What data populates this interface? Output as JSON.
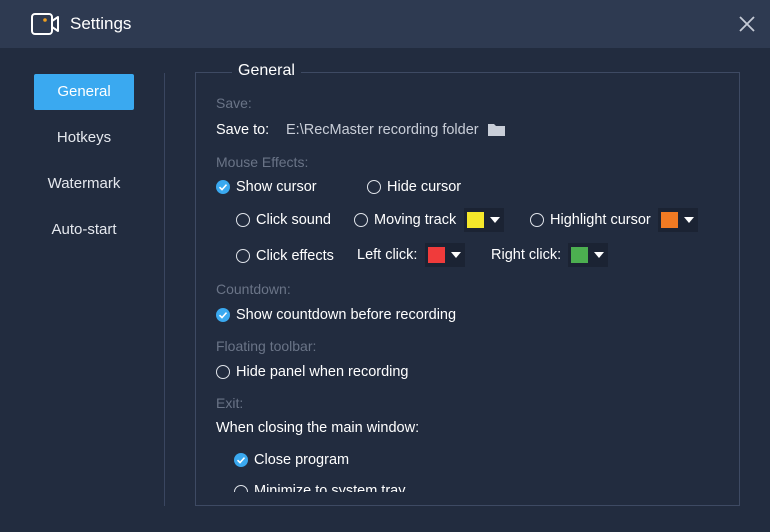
{
  "window": {
    "title": "Settings"
  },
  "sidebar": {
    "items": [
      {
        "label": "General",
        "active": true
      },
      {
        "label": "Hotkeys"
      },
      {
        "label": "Watermark"
      },
      {
        "label": "Auto-start"
      }
    ]
  },
  "general": {
    "title": "General",
    "save": {
      "section_label": "Save:",
      "save_to_label": "Save to:",
      "path": "E:\\RecMaster recording folder"
    },
    "mouse_effects": {
      "section_label": "Mouse Effects:",
      "show_cursor": {
        "label": "Show cursor",
        "checked": true
      },
      "hide_cursor": {
        "label": "Hide cursor",
        "checked": false
      },
      "click_sound": {
        "label": "Click sound",
        "checked": false
      },
      "moving_track": {
        "label": "Moving track",
        "checked": false,
        "color": "#f5e72a"
      },
      "highlight_cursor": {
        "label": "Highlight cursor",
        "checked": false,
        "color": "#f07a23"
      },
      "click_effects": {
        "label": "Click effects",
        "checked": false
      },
      "left_click": {
        "label": "Left click:",
        "color": "#f03b3b"
      },
      "right_click": {
        "label": "Right click:",
        "color": "#4caf50"
      }
    },
    "countdown": {
      "section_label": "Countdown:",
      "show_countdown": {
        "label": "Show countdown before recording",
        "checked": true
      }
    },
    "floating_toolbar": {
      "section_label": "Floating toolbar:",
      "hide_panel": {
        "label": "Hide panel when recording",
        "checked": false
      }
    },
    "exit": {
      "section_label": "Exit:",
      "prompt": "When closing the main window:",
      "close_program": {
        "label": "Close program",
        "checked": true
      },
      "minimize_tray": {
        "label": "Minimize to system tray",
        "checked": false
      }
    }
  },
  "colors": {
    "accent": "#3aa9f0",
    "background": "#222c3f",
    "titlebar": "#2e3a51"
  }
}
